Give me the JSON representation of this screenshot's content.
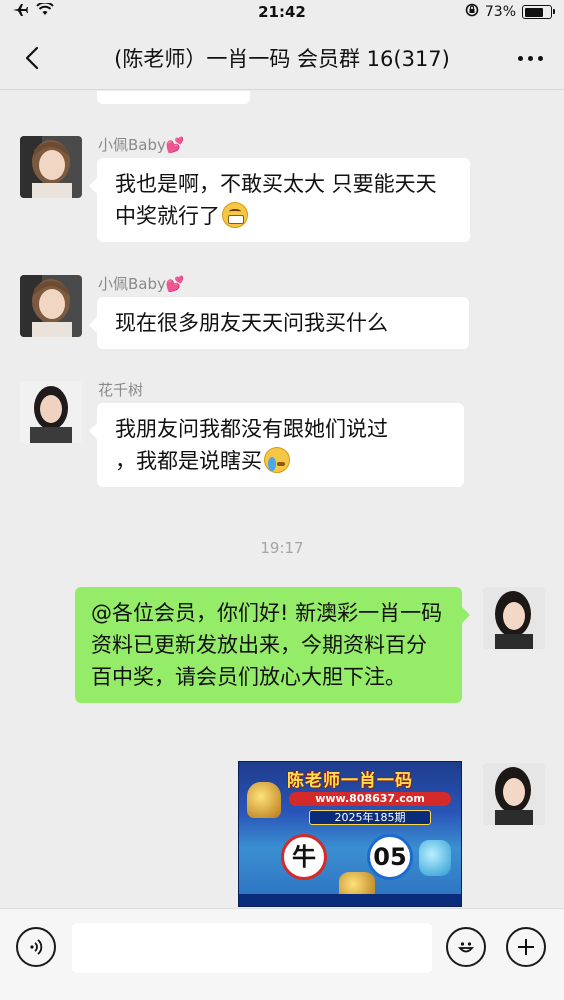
{
  "status_bar": {
    "time": "21:42",
    "battery_text": "73%",
    "battery_level": 0.73
  },
  "nav": {
    "title": "(陈老师）一肖一码 会员群 16(317)"
  },
  "messages": [
    {
      "sender": "小佩Baby",
      "text": "我也是啊，不敢买太大 只要能天天中奖就行了",
      "emoji": "grinning-face"
    },
    {
      "sender": "小佩Baby",
      "text": "现在很多朋友天天问我买什么"
    },
    {
      "sender": "花千树",
      "text_line1": "我朋友问我都没有跟她们说过",
      "text_line2": "，我都是说瞎买",
      "emoji": "crying-face"
    }
  ],
  "timestamp": "19:17",
  "outgoing": {
    "text": "@各位会员，你们好! 新澳彩一肖一码资料已更新发放出来，今期资料百分百中奖，请会员们放心大胆下注。"
  },
  "promo": {
    "title": "陈老师一肖一码",
    "url": "www.808637.com",
    "period": "2025年185期",
    "zodiac": "牛",
    "number": "05"
  },
  "icons": {
    "status_left": [
      "airplane-icon",
      "wifi-icon"
    ],
    "status_right": [
      "rotation-lock-icon",
      "battery-icon"
    ],
    "nav": [
      "back-icon",
      "more-icon"
    ],
    "input_bar": [
      "voice-icon",
      "emoji-icon",
      "plus-icon"
    ]
  },
  "colors": {
    "background": "#ededed",
    "incoming_bubble": "#ffffff",
    "outgoing_bubble": "#95ec69",
    "sender_name": "#8a8a8a",
    "heart": "#e85aa4"
  }
}
